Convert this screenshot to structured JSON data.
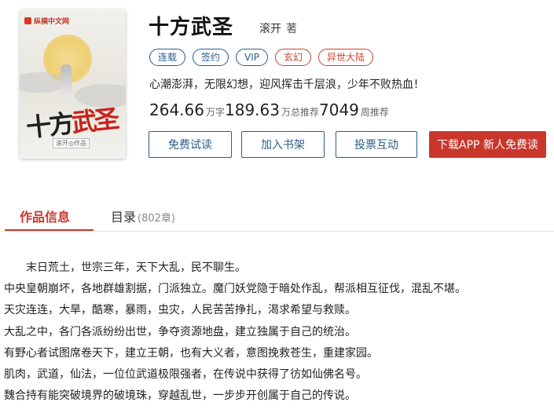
{
  "cover": {
    "brand": "纵横中文网",
    "title_black": "十方",
    "title_red": "武圣",
    "author_tag": "滚开◎作品"
  },
  "book": {
    "title": "十方武圣",
    "author": "滚开",
    "author_suffix": "著",
    "tags": [
      {
        "label": "连载",
        "style": "blue"
      },
      {
        "label": "签约",
        "style": "blue"
      },
      {
        "label": "VIP",
        "style": "blue"
      },
      {
        "label": "玄幻",
        "style": "red"
      },
      {
        "label": "异世大陆",
        "style": "red"
      }
    ],
    "intro": "心潮澎湃，无限幻想，迎风挥击千层浪，少年不败热血！",
    "stats": [
      {
        "value": "264.66",
        "unit": "万字"
      },
      {
        "value": "189.63",
        "unit": "万总推荐"
      },
      {
        "value": "7049",
        "unit": "周推荐"
      }
    ]
  },
  "actions": {
    "free_read": "免费试读",
    "add_shelf": "加入书架",
    "vote": "投票互动",
    "download": "下载APP 新人免费读"
  },
  "tabs": {
    "info": "作品信息",
    "catalog": "目录",
    "catalog_count": "(802章)"
  },
  "description": [
    "末日荒土，世宗三年，天下大乱，民不聊生。",
    "中央皇朝崩坏，各地群雄割据，门派独立。魔门妖党隐于暗处作乱，帮派相互征伐，混乱不堪。",
    "天灾连连，大旱，酷寒，暴雨，虫灾，人民苦苦挣扎，渴求希望与救赎。",
    "大乱之中，各门各派纷纷出世，争夺资源地盘，建立独属于自己的统治。",
    "有野心者试图席卷天下，建立王朝，也有大义者，意图挽救苍生，重建家园。",
    "肌肉，武道，仙法，一位位武道极限强者，在传说中获得了彷如仙佛名号。",
    "魏合持有能突破境界的破境珠，穿越乱世，一步步开创属于自己的传说。"
  ],
  "colors": {
    "accent_red": "#c9372c",
    "accent_blue": "#2b5c8a"
  }
}
